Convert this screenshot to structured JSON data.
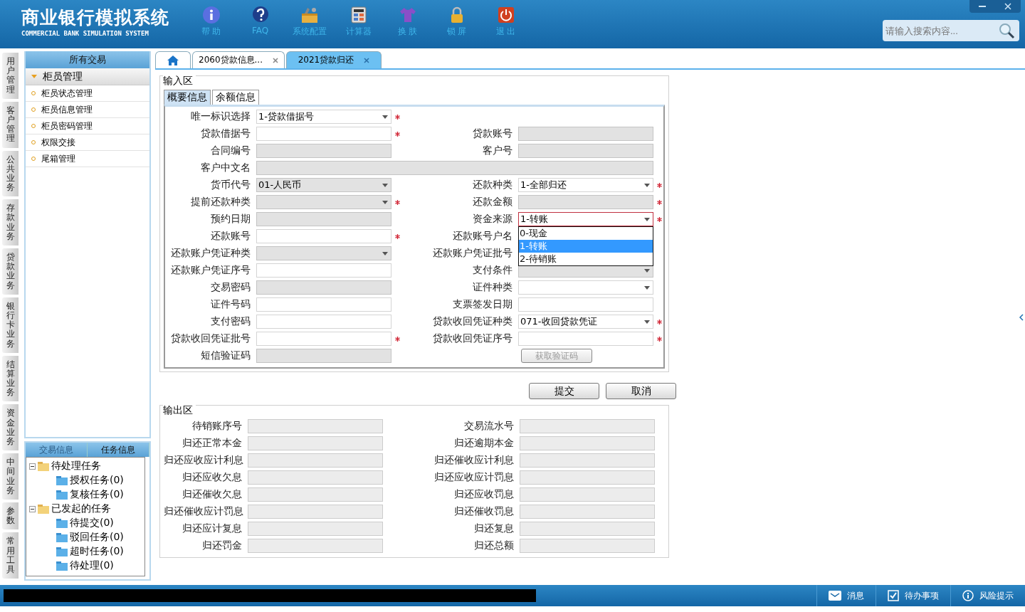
{
  "header": {
    "title": "商业银行模拟系统",
    "subtitle": "COMMERCIAL BANK SIMULATION SYSTEM",
    "tools": [
      {
        "kind": "help",
        "label": "帮 助"
      },
      {
        "kind": "faq",
        "label": "FAQ"
      },
      {
        "kind": "config",
        "label": "系统配置"
      },
      {
        "kind": "calculator",
        "label": "计算器"
      },
      {
        "kind": "skin",
        "label": "换 肤"
      },
      {
        "kind": "lock",
        "label": "锁 屏"
      },
      {
        "kind": "exit",
        "label": "退 出"
      }
    ],
    "search": {
      "placeholder": "请输入搜索内容..."
    }
  },
  "module_tabs": [
    {
      "label": "用户管理",
      "selected": false
    },
    {
      "label": "客户管理",
      "selected": false
    },
    {
      "label": "公共业务",
      "selected": false
    },
    {
      "label": "存款业务",
      "selected": false
    },
    {
      "label": "贷款业务",
      "selected": false
    },
    {
      "label": "银行卡业务",
      "selected": false
    },
    {
      "label": "结算业务",
      "selected": false
    },
    {
      "label": "资金业务",
      "selected": false
    },
    {
      "label": "中间业务",
      "selected": false
    },
    {
      "label": "参数",
      "selected": false
    },
    {
      "label": "常用工具",
      "selected": false
    }
  ],
  "sidebar": {
    "title": "所有交易",
    "group": {
      "label": "柜员管理",
      "expanded": true
    },
    "items": [
      "柜员状态管理",
      "柜员信息管理",
      "柜员密码管理",
      "权限交接",
      "尾箱管理"
    ],
    "bottom_tabs": [
      {
        "label": "交易信息",
        "selected": false
      },
      {
        "label": "任务信息",
        "selected": true
      }
    ],
    "tree": [
      {
        "label": "待处理任务",
        "expanded": true,
        "children": [
          {
            "label": "授权任务(0)"
          },
          {
            "label": "复核任务(0)"
          }
        ]
      },
      {
        "label": "已发起的任务",
        "expanded": true,
        "children": [
          {
            "label": "待提交(0)"
          },
          {
            "label": "驳回任务(0)"
          },
          {
            "label": "超时任务(0)"
          },
          {
            "label": "待处理(0)"
          }
        ]
      }
    ]
  },
  "doc_tabs": [
    {
      "kind": "home",
      "selected": false
    },
    {
      "kind": "page",
      "label": "2060贷款信息...",
      "selected": false
    },
    {
      "kind": "page",
      "label": "2021贷款归还",
      "selected": true
    }
  ],
  "input_area": {
    "title": "输入区",
    "tabs": [
      {
        "label": "概要信息",
        "selected": true
      },
      {
        "label": "余额信息",
        "selected": false
      }
    ],
    "rows": [
      {
        "left": {
          "label": "唯一标识选择",
          "kind": "select",
          "value": "1-贷款借据号",
          "required": true,
          "disabled": false
        }
      },
      {
        "left": {
          "label": "贷款借据号",
          "kind": "input",
          "required": true,
          "disabled": false
        },
        "right": {
          "label": "贷款账号",
          "kind": "input",
          "disabled": true
        }
      },
      {
        "left": {
          "label": "合同编号",
          "kind": "input",
          "disabled": true
        },
        "right": {
          "label": "客户号",
          "kind": "input",
          "disabled": true
        }
      },
      {
        "left": {
          "label": "客户中文名",
          "kind": "wide",
          "disabled": true
        }
      },
      {
        "left": {
          "label": "货币代号",
          "kind": "select",
          "value": "01-人民币",
          "disabled": true
        },
        "right": {
          "label": "还款种类",
          "kind": "select",
          "value": "1-全部归还",
          "required": true,
          "disabled": false
        }
      },
      {
        "left": {
          "label": "提前还款种类",
          "kind": "select",
          "required": true,
          "disabled": true
        },
        "right": {
          "label": "还款金额",
          "kind": "input",
          "required": true,
          "disabled": true
        }
      },
      {
        "left": {
          "label": "预约日期",
          "kind": "input",
          "disabled": true
        },
        "right": {
          "label": "资金来源",
          "kind": "select",
          "value": "1-转账",
          "required": true,
          "disabled": false,
          "focused": true,
          "options": [
            {
              "label": "0-现金",
              "selected": false
            },
            {
              "label": "1-转账",
              "selected": true
            },
            {
              "label": "2-待销账",
              "selected": false
            }
          ]
        }
      },
      {
        "left": {
          "label": "还款账号",
          "kind": "input",
          "required": true,
          "disabled": false
        },
        "right": {
          "label": "还款账号户名",
          "kind": "hidden"
        }
      },
      {
        "left": {
          "label": "还款账户凭证种类",
          "kind": "select",
          "disabled": true
        },
        "right": {
          "label": "还款账户凭证批号",
          "kind": "hidden"
        }
      },
      {
        "left": {
          "label": "还款账户凭证序号",
          "kind": "input",
          "disabled": false
        },
        "right": {
          "label": "支付条件",
          "kind": "select",
          "disabled": true
        }
      },
      {
        "left": {
          "label": "交易密码",
          "kind": "input",
          "disabled": true
        },
        "right": {
          "label": "证件种类",
          "kind": "select",
          "disabled": false
        }
      },
      {
        "left": {
          "label": "证件号码",
          "kind": "input",
          "disabled": false
        },
        "right": {
          "label": "支票签发日期",
          "kind": "input",
          "disabled": false
        }
      },
      {
        "left": {
          "label": "支付密码",
          "kind": "input",
          "disabled": false
        },
        "right": {
          "label": "贷款收回凭证种类",
          "kind": "select",
          "value": "071-收回贷款凭证",
          "required": true,
          "disabled": false
        }
      },
      {
        "left": {
          "label": "贷款收回凭证批号",
          "kind": "input",
          "required": true,
          "disabled": false
        },
        "right": {
          "label": "贷款收回凭证序号",
          "kind": "input",
          "required": true,
          "disabled": false
        }
      },
      {
        "left": {
          "label": "短信验证码",
          "kind": "input",
          "disabled": true
        },
        "right": {
          "kind": "button",
          "label": "获取验证码",
          "disabled": true
        }
      }
    ]
  },
  "actions": [
    "提交",
    "取消"
  ],
  "output_area": {
    "title": "输出区",
    "rows": [
      [
        "待销账序号",
        "交易流水号"
      ],
      [
        "归还正常本金",
        "归还逾期本金"
      ],
      [
        "归还应收应计利息",
        "归还催收应计利息"
      ],
      [
        "归还应收欠息",
        "归还应收应计罚息"
      ],
      [
        "归还催收欠息",
        "归还应收罚息"
      ],
      [
        "归还催收应计罚息",
        "归还催收罚息"
      ],
      [
        "归还应计复息",
        "归还复息"
      ],
      [
        "归还罚金",
        "归还总额"
      ]
    ]
  },
  "status_bar": {
    "items": [
      {
        "kind": "message",
        "label": "消息"
      },
      {
        "kind": "todo",
        "label": "待办事项"
      },
      {
        "kind": "risk",
        "label": "风险提示"
      }
    ]
  }
}
